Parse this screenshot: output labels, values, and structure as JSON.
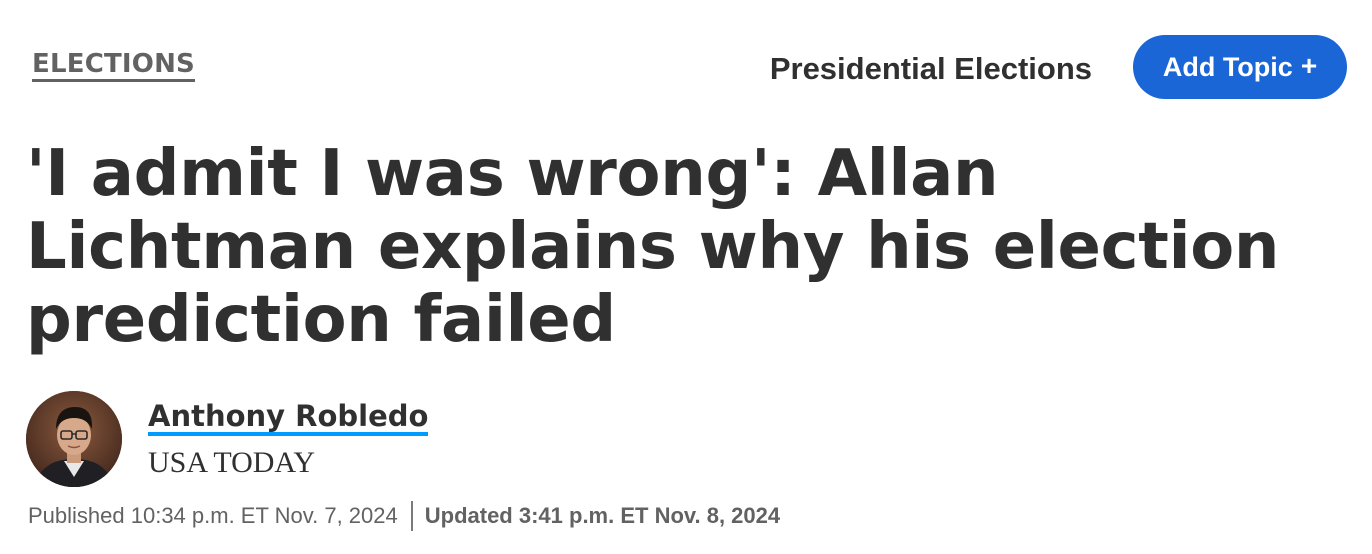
{
  "header": {
    "section_label": "ELECTIONS",
    "topic_label": "Presidential Elections",
    "add_topic_label": "Add Topic",
    "add_topic_icon": "+",
    "accent_color": "#1a66d6"
  },
  "article": {
    "headline": "'I admit I was wrong': Allan Lichtman explains why his election prediction failed",
    "author": {
      "name": "Anthony Robledo",
      "affiliation": "USA TODAY",
      "avatar_icon": "author-photo",
      "link_underline_color": "#009bff"
    },
    "published": "Published 10:34 p.m. ET Nov. 7, 2024",
    "updated": "Updated 3:41 p.m. ET Nov. 8, 2024"
  }
}
